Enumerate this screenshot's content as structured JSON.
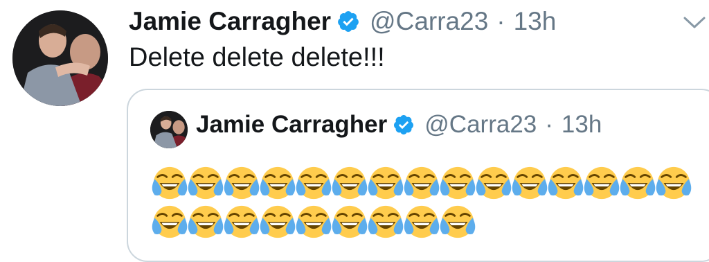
{
  "tweet": {
    "display_name": "Jamie Carragher",
    "handle": "@Carra23",
    "separator": "·",
    "time": "13h",
    "text": "Delete delete delete!!!",
    "avatar_icon": "profile-photo",
    "verified_icon": "verified-badge-icon",
    "menu_icon": "chevron-down-icon"
  },
  "quoted_tweet": {
    "display_name": "Jamie Carragher",
    "handle": "@Carra23",
    "separator": "·",
    "time": "13h",
    "emoji_icon": "face-with-tears-of-joy-icon",
    "emoji_rows": [
      15,
      9
    ]
  },
  "colors": {
    "text": "#14171a",
    "secondary": "#657786",
    "verified_blue": "#1da1f2",
    "border": "#ccd6dd"
  }
}
